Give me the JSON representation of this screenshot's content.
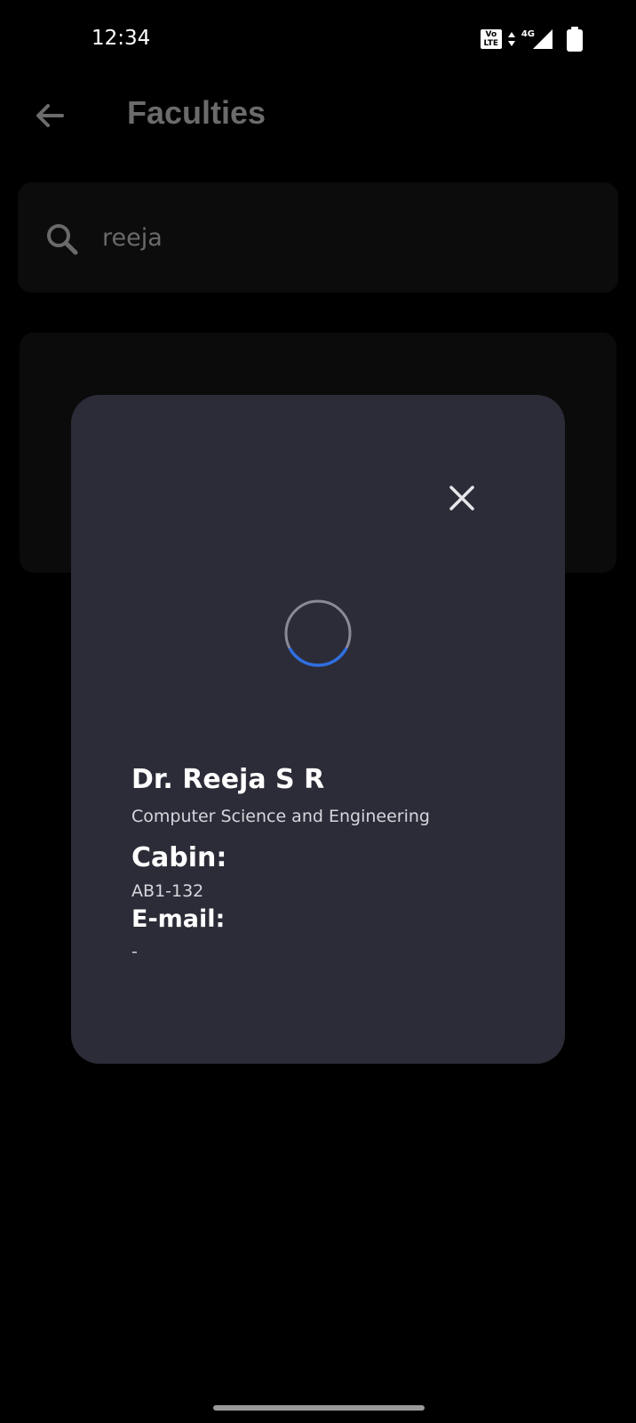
{
  "status_bar": {
    "time": "12:34",
    "volte_label": "Vo LTE",
    "network_label": "4G",
    "icons": [
      "volte-icon",
      "data-arrows-icon",
      "signal-icon",
      "battery-icon"
    ]
  },
  "app_bar": {
    "title": "Faculties",
    "back_icon": "arrow-left-icon"
  },
  "search": {
    "value": "reeja",
    "icon": "search-icon"
  },
  "modal": {
    "close_icon": "close-icon",
    "loading_indicator": "spinner",
    "name": "Dr. Reeja S R",
    "department": "Computer Science and Engineering",
    "cabin_heading": "Cabin:",
    "cabin_value": "AB1-132",
    "email_heading": "E-mail:",
    "email_value": "-"
  },
  "colors": {
    "background": "#000000",
    "modal_background": "#2c2c38",
    "card_background": "#0c0c0c",
    "spinner_track": "#8a8a95",
    "spinner_accent": "#2f6fe0",
    "dimmed_text": "#6b6b6b"
  }
}
